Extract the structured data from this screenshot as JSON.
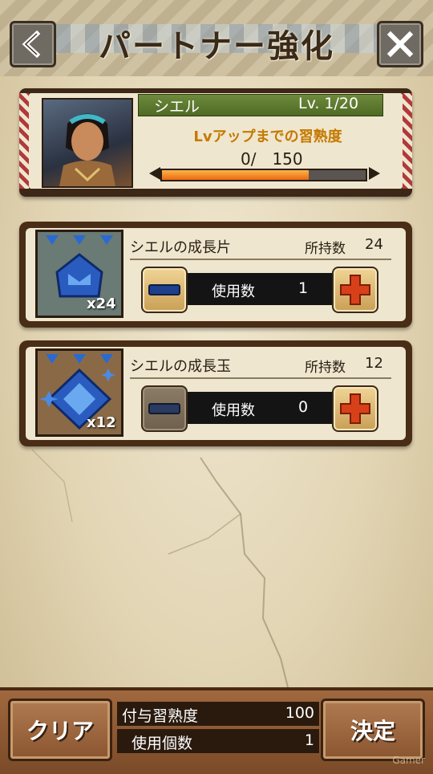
{
  "header": {
    "title": "パートナー強化",
    "back_icon": "chevron-left-icon",
    "close_icon": "close-icon"
  },
  "partner": {
    "name": "シエル",
    "level": "Lv. 1/20",
    "exp_label": "Lvアップまでの習熟度",
    "exp_value": "0/　150",
    "exp_progress": 0.72
  },
  "items": [
    {
      "name": "シエルの成長片",
      "owned_label": "所持数",
      "owned": "24",
      "icon_count": "x24",
      "use_label": "使用数",
      "use_value": "1",
      "minus_enabled": true,
      "plus_enabled": true
    },
    {
      "name": "シエルの成長玉",
      "owned_label": "所持数",
      "owned": "12",
      "icon_count": "x12",
      "use_label": "使用数",
      "use_value": "0",
      "minus_enabled": false,
      "plus_enabled": true
    }
  ],
  "footer": {
    "clear_label": "クリア",
    "decide_label": "決定",
    "granted_exp_label": "付与習熟度",
    "granted_exp_value": "100",
    "used_count_label": "使用個数",
    "used_count_value": "1",
    "watermark": "Gamer"
  },
  "colors": {
    "accent_orange": "#e86a10",
    "name_bar_green": "#5a7a2c",
    "plus_red": "#d8401a",
    "minus_blue": "#1e3f8a"
  }
}
